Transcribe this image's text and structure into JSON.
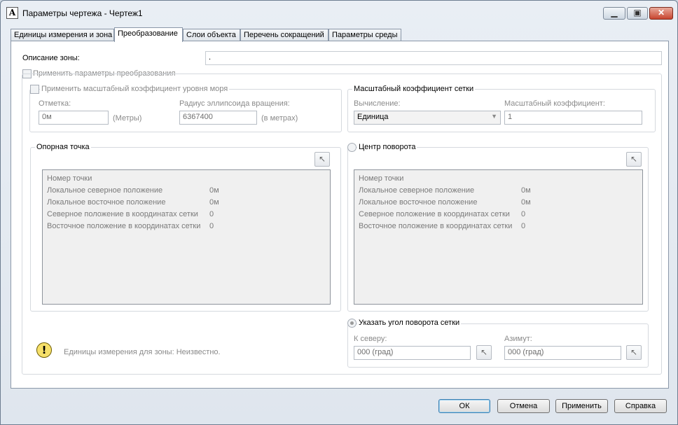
{
  "window": {
    "title": "Параметры чертежа - Чертеж1"
  },
  "titlebar": {
    "minimize_glyph": "▁",
    "maximize_glyph": "▣",
    "close_glyph": "✕"
  },
  "tabs": [
    {
      "label": "Единицы измерения и зона"
    },
    {
      "label": "Преобразование"
    },
    {
      "label": "Слои объекта"
    },
    {
      "label": "Перечень сокращений"
    },
    {
      "label": "Параметры среды"
    }
  ],
  "zone": {
    "label": "Описание зоны:",
    "value": "."
  },
  "transform": {
    "apply_label": "Применить параметры преобразования",
    "sea_level": {
      "apply_label": "Применить масштабный коэффициент уровня моря",
      "elevation_label": "Отметка:",
      "elevation_value": "0м",
      "elevation_unit": "(Метры)",
      "radius_label": "Радиус эллипсоида вращения:",
      "radius_value": "6367400",
      "radius_unit": "(в метрах)"
    },
    "grid_scale": {
      "title": "Масштабный коэффициент сетки",
      "calc_label": "Вычисление:",
      "calc_value": "Единица",
      "factor_label": "Масштабный коэффициент:",
      "factor_value": "1"
    },
    "ref_point": {
      "title": "Опорная точка",
      "rows": [
        {
          "label": "Номер точки",
          "value": ""
        },
        {
          "label": "Локальное северное положение",
          "value": "0м"
        },
        {
          "label": "Локальное восточное положение",
          "value": "0м"
        },
        {
          "label": "Северное положение в координатах сетки",
          "value": "0"
        },
        {
          "label": "Восточное положение в координатах сетки",
          "value": "0"
        }
      ]
    },
    "rotation_center": {
      "title": "Центр поворота",
      "rows": [
        {
          "label": "Номер точки",
          "value": ""
        },
        {
          "label": "Локальное северное положение",
          "value": "0м"
        },
        {
          "label": "Локальное восточное положение",
          "value": "0м"
        },
        {
          "label": "Северное положение в координатах сетки",
          "value": "0"
        },
        {
          "label": "Восточное положение в координатах сетки",
          "value": "0"
        }
      ]
    },
    "grid_rotation": {
      "title": "Указать угол поворота сетки",
      "north_label": "К северу:",
      "north_value": "000 (град)",
      "azimuth_label": "Азимут:",
      "azimuth_value": "000 (град)"
    }
  },
  "hint": {
    "text": "Единицы измерения для зоны: Неизвестно.",
    "icon": "exclamation-bulb-icon",
    "glyph": "!"
  },
  "pick_glyph": "↖",
  "buttons": {
    "ok": "ОК",
    "cancel": "Отмена",
    "apply": "Применить",
    "help": "Справка"
  }
}
